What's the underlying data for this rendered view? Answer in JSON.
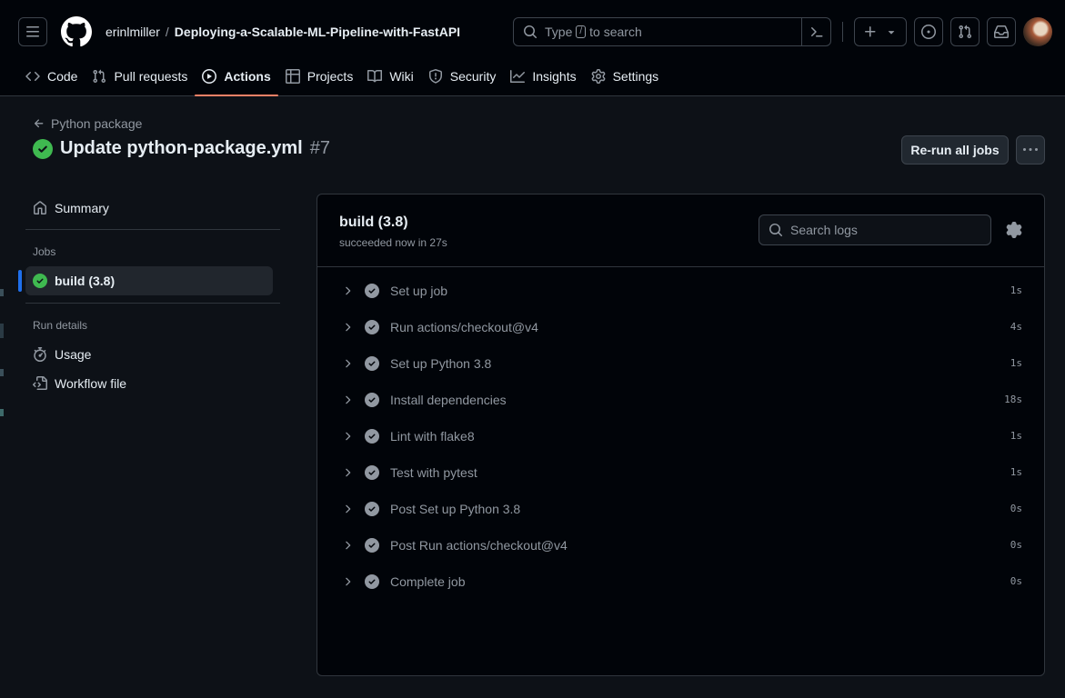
{
  "header": {
    "repo_owner": "erinlmiller",
    "repo_separator": "/",
    "repo_name": "Deploying-a-Scalable-ML-Pipeline-with-FastAPI",
    "search_prefix": "Type",
    "search_key": "/",
    "search_suffix": "to search",
    "icons": [
      "menu-icon",
      "github-logo-icon",
      "search-icon",
      "command-palette-icon",
      "plus-icon",
      "chevron-down-icon",
      "issues-icon",
      "pull-request-icon",
      "inbox-icon",
      "avatar"
    ]
  },
  "nav": {
    "items": [
      {
        "label": "Code",
        "icon": "code-icon"
      },
      {
        "label": "Pull requests",
        "icon": "pull-request-icon"
      },
      {
        "label": "Actions",
        "icon": "play-icon",
        "active": true
      },
      {
        "label": "Projects",
        "icon": "table-icon"
      },
      {
        "label": "Wiki",
        "icon": "book-icon"
      },
      {
        "label": "Security",
        "icon": "shield-icon"
      },
      {
        "label": "Insights",
        "icon": "graph-icon"
      },
      {
        "label": "Settings",
        "icon": "gear-icon"
      }
    ]
  },
  "run": {
    "back_label": "Python package",
    "title": "Update python-package.yml",
    "number": "#7",
    "rerun_label": "Re-run all jobs"
  },
  "sidebar": {
    "summary_label": "Summary",
    "jobs_heading": "Jobs",
    "job_label": "build (3.8)",
    "run_details_heading": "Run details",
    "usage_label": "Usage",
    "workflow_file_label": "Workflow file"
  },
  "job": {
    "title": "build (3.8)",
    "subtitle": "succeeded now in 27s",
    "search_placeholder": "Search logs",
    "steps": [
      {
        "name": "Set up job",
        "duration": "1s"
      },
      {
        "name": "Run actions/checkout@v4",
        "duration": "4s"
      },
      {
        "name": "Set up Python 3.8",
        "duration": "1s"
      },
      {
        "name": "Install dependencies",
        "duration": "18s"
      },
      {
        "name": "Lint with flake8",
        "duration": "1s"
      },
      {
        "name": "Test with pytest",
        "duration": "1s"
      },
      {
        "name": "Post Set up Python 3.8",
        "duration": "0s"
      },
      {
        "name": "Post Run actions/checkout@v4",
        "duration": "0s"
      },
      {
        "name": "Complete job",
        "duration": "0s"
      }
    ]
  },
  "colors": {
    "success": "#3fb950",
    "accent_underline": "#f78166",
    "active_bar": "#1f6feb"
  }
}
